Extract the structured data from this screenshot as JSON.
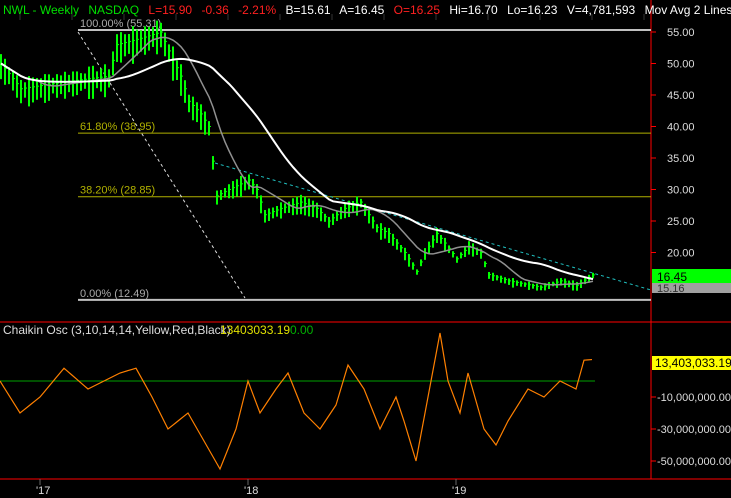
{
  "header": {
    "symbol": "NWL - Weekly",
    "exchange": "NASDAQ",
    "last": "L=15.90",
    "change": "-0.36",
    "change_pct": "-2.21%",
    "bid": "B=15.61",
    "ask": "A=16.45",
    "open": "O=16.25",
    "high": "Hi=16.70",
    "low": "Lo=16.23",
    "volume": "V=4,781,593",
    "studies": "Mov Avg 2 Lines ( ..."
  },
  "colors": {
    "up": "#00ff00",
    "down": "#ff2020",
    "fib": "#b0b000",
    "axis": "#ff0000",
    "ma_fast": "#909090",
    "ma_slow": "#ffffff",
    "trend": "#20c0c0",
    "chaikin": "#ff8000",
    "zero": "#00a000"
  },
  "chart_data": [
    {
      "type": "line",
      "title": "NWL - Weekly",
      "ylim": [
        10,
        58
      ],
      "yticks": [
        "55.00",
        "50.00",
        "45.00",
        "40.00",
        "35.00",
        "30.00",
        "25.00",
        "20.00"
      ],
      "ytick_values": [
        55,
        50,
        45,
        40,
        35,
        30,
        25,
        20
      ],
      "xticks": [
        {
          "label": "'17",
          "week": 10
        },
        {
          "label": "'18",
          "week": 62
        },
        {
          "label": "'19",
          "week": 114
        }
      ],
      "price_keypoints": [
        [
          0,
          50
        ],
        [
          5,
          46
        ],
        [
          15,
          47
        ],
        [
          27,
          48
        ],
        [
          29,
          53
        ],
        [
          35,
          54
        ],
        [
          40,
          55
        ],
        [
          42,
          52
        ],
        [
          45,
          48
        ],
        [
          47,
          44
        ],
        [
          50,
          42
        ],
        [
          52,
          40
        ],
        [
          54,
          29
        ],
        [
          57,
          30
        ],
        [
          62,
          31.5
        ],
        [
          64,
          30
        ],
        [
          66,
          26
        ],
        [
          70,
          27
        ],
        [
          75,
          28
        ],
        [
          79,
          27
        ],
        [
          82,
          25
        ],
        [
          86,
          27
        ],
        [
          90,
          28
        ],
        [
          94,
          24
        ],
        [
          97,
          23
        ],
        [
          101,
          20
        ],
        [
          104,
          17
        ],
        [
          106,
          20
        ],
        [
          109,
          23
        ],
        [
          111,
          21.5
        ],
        [
          114,
          19
        ],
        [
          117,
          21
        ],
        [
          120,
          20
        ],
        [
          122,
          16.5
        ],
        [
          127,
          15.5
        ],
        [
          135,
          14.5
        ],
        [
          140,
          15.5
        ],
        [
          144,
          14.8
        ],
        [
          148,
          16.45
        ]
      ],
      "moving_averages": [
        {
          "name": "fast",
          "period": 10
        },
        {
          "name": "slow",
          "period": 30
        }
      ],
      "fib_levels": [
        {
          "label": "100.00% (55.31)",
          "value": 55.31
        },
        {
          "label": "61.80% (38.95)",
          "value": 38.95
        },
        {
          "label": "38.20% (28.85)",
          "value": 28.85
        },
        {
          "label": "0.00% (12.49)",
          "value": 12.49
        }
      ],
      "last_price_label": "16.45",
      "ma_label": "15.16"
    },
    {
      "type": "line",
      "title": "Chaikin Osc (3,10,14,14,Yellow,Red,Black)",
      "value_label": "13403033.19",
      "zero_label": "0.00",
      "last_label": "13,403,033.19",
      "ylim": [
        -58,
        20
      ],
      "yticks": [
        "-10,000,000.00",
        "-30,000,000.00",
        "-50,000,000.00"
      ],
      "ytick_values": [
        -10,
        -30,
        -50
      ],
      "unit": "millions",
      "keypoints": [
        [
          0,
          0
        ],
        [
          5,
          -20
        ],
        [
          10,
          -10
        ],
        [
          16,
          8
        ],
        [
          22,
          -5
        ],
        [
          30,
          5
        ],
        [
          34,
          8
        ],
        [
          38,
          -10
        ],
        [
          42,
          -30
        ],
        [
          47,
          -20
        ],
        [
          55,
          -55
        ],
        [
          59,
          -30
        ],
        [
          62,
          0
        ],
        [
          65,
          -20
        ],
        [
          69,
          -5
        ],
        [
          72,
          5
        ],
        [
          76,
          -20
        ],
        [
          80,
          -30
        ],
        [
          84,
          -15
        ],
        [
          87,
          10
        ],
        [
          91,
          -5
        ],
        [
          95,
          -30
        ],
        [
          99,
          -10
        ],
        [
          101,
          -25
        ],
        [
          104,
          -50
        ],
        [
          107,
          -10
        ],
        [
          110,
          30
        ],
        [
          112,
          0
        ],
        [
          115,
          -20
        ],
        [
          117,
          5
        ],
        [
          121,
          -30
        ],
        [
          124,
          -40
        ],
        [
          127,
          -25
        ],
        [
          132,
          -5
        ],
        [
          136,
          -10
        ],
        [
          140,
          0
        ],
        [
          144,
          -5
        ],
        [
          146,
          13
        ],
        [
          148,
          13.4
        ]
      ]
    }
  ]
}
